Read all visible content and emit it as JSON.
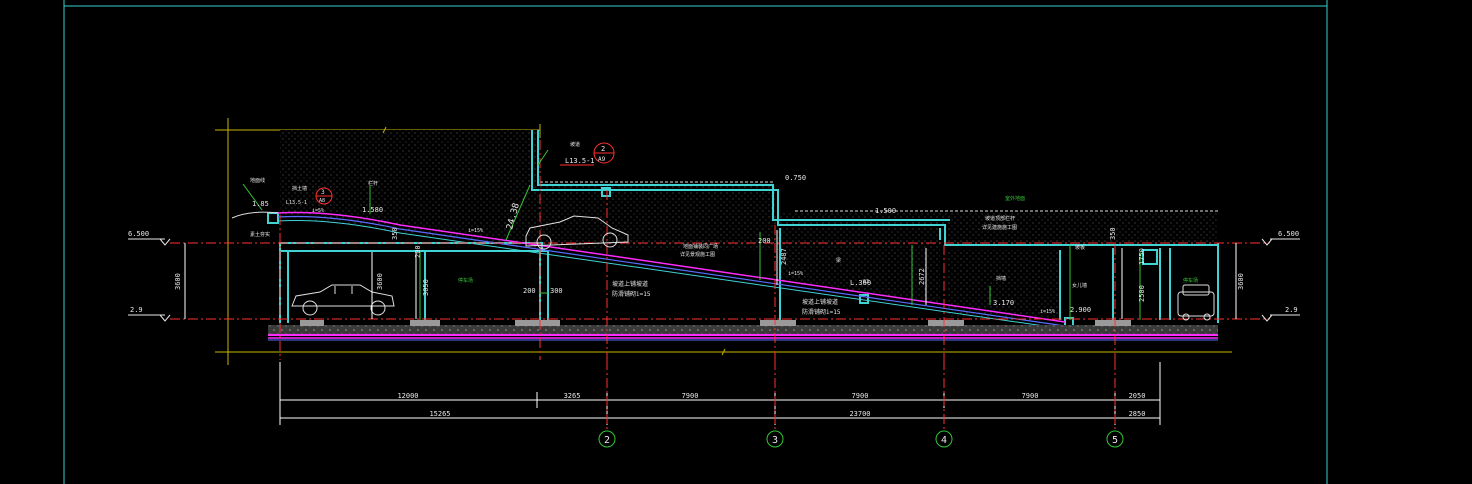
{
  "colors": {
    "background": "#000000",
    "frame": "#39d0d0",
    "structure": "#3fd3d3",
    "ramp_magenta": "#ff2bff",
    "ramp_blue": "#5a6cff",
    "level_red": "#ff3030",
    "dimension": "#ffffff",
    "axis_green": "#34c634",
    "extent_yellow": "#c8b400",
    "label_white": "#e8e8e8",
    "grid_green": "#34c634",
    "hatch": "#888888"
  },
  "levels": {
    "left_top": "6.500",
    "left_bottom": "2.9",
    "right_top": "6.500",
    "right_bottom": "2.9",
    "height_left": "3600",
    "height_right": "3600"
  },
  "axes": [
    {
      "label": "2"
    },
    {
      "label": "3"
    },
    {
      "label": "4"
    },
    {
      "label": "5"
    }
  ],
  "dimensions_row1": [
    "12000",
    "3265",
    "7900",
    "7900",
    "7900",
    "2050"
  ],
  "dimensions_row2": [
    "15265",
    "23700",
    "2850"
  ],
  "annotations": {
    "detail_ref_top": "L13.5-1",
    "detail_ref_circle_top": "2",
    "detail_ref_circle_bottom": "A9",
    "detail_ref_left": "L13.5-1",
    "detail_ref_left_circle_top": "3",
    "detail_ref_left_circle_bottom": "A8",
    "elev_1580": "1.580",
    "elev_750": "0.750",
    "elev_3170": "3.170",
    "elev_2900": "2.900",
    "elev_1500": "1.500",
    "elev_1360": "L.360",
    "elev_185": "1.85",
    "slope_angle": "24.38",
    "slope_left": "i=15%",
    "slope_mid": "i=15%",
    "slope_right": "i=15%",
    "slope_top": "i=5%",
    "ramp_note_1": "坡道上铺坡道",
    "ramp_note_2": "防滑铺砌i=15",
    "ramp_note_3": "坡道上铺坡道",
    "ramp_note_4": "防滑铺砌i=15",
    "mid_label_a": "地面铺装同广场",
    "mid_label_b": "详见景观施工图",
    "right_label_a": "坡道顶部栏杆",
    "right_label_b": "详见建施施工图",
    "green_label_left": "停车场",
    "green_label_top": "室外地面",
    "green_label_right": "停车场",
    "label_parapet": "女儿墙",
    "label_top_left": "栏杆",
    "label_left_1": "地面线",
    "label_left_2": "挡土墙",
    "label_left_3": "素土夯实",
    "label_beam": "梁",
    "label_wall": "挡墙",
    "label_ramp": "坡道",
    "label_ramp_slab": "坡板",
    "dim_200_a": "200",
    "dim_300": "300",
    "dim_200_b": "200",
    "dim_350_a": "350",
    "dim_350_b": "350",
    "dim_200_c": "200",
    "dim_3600_a": "3600",
    "dim_3050": "3050",
    "dim_2487": "2487",
    "dim_2672": "2672",
    "dim_1750": "1750",
    "dim_2500": "2500",
    "dim_g3": "G3"
  }
}
